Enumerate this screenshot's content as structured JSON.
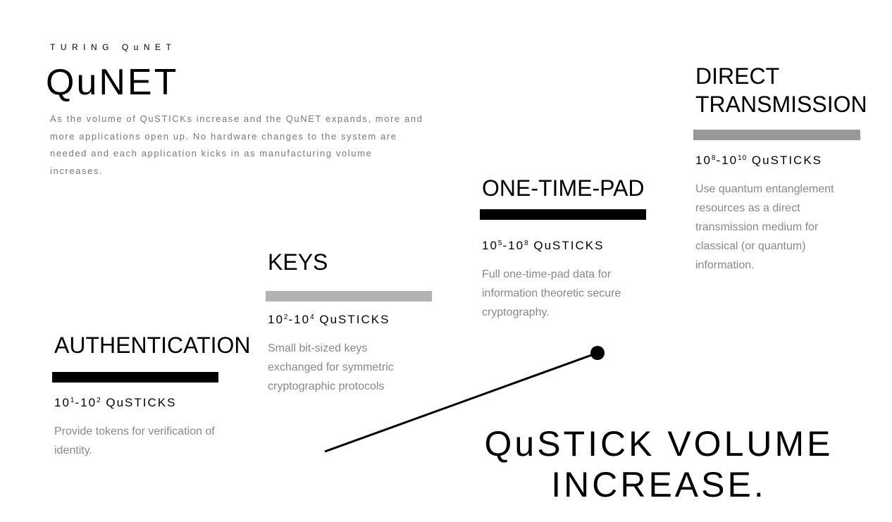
{
  "header": {
    "eyebrow": "TURING QuNET",
    "title": "QuNET",
    "intro": "As the volume of QuSTICKs increase and the QuNET expands, more and more applications open up.  No hardware changes to the system are needed and each application kicks in as manufacturing volume increases."
  },
  "colors": {
    "bar_black": "#000000",
    "bar_light_gray": "#b3b3b3",
    "bar_mid_gray": "#999999",
    "desc_text": "#888888"
  },
  "stages": [
    {
      "title": "AUTHENTICATION",
      "volume_base1": "10",
      "volume_exp1": "1",
      "volume_sep": "-",
      "volume_base2": "10",
      "volume_exp2": "2",
      "volume_unit": " QuSTICKS",
      "description": "Provide tokens for verification of identity.",
      "bar_color": "#000000"
    },
    {
      "title": "KEYS",
      "volume_base1": "10",
      "volume_exp1": "2",
      "volume_sep": "-",
      "volume_base2": "10",
      "volume_exp2": "4",
      "volume_unit": " QuSTICKS",
      "description": "Small bit-sized keys exchanged for symmetric cryptographic protocols",
      "bar_color": "#b3b3b3"
    },
    {
      "title": "ONE-TIME-PAD",
      "volume_base1": "10",
      "volume_exp1": "5",
      "volume_sep": "-",
      "volume_base2": "10",
      "volume_exp2": "8",
      "volume_unit": " QuSTICKS",
      "description": "Full one-time-pad data for information theoretic secure cryptography.",
      "bar_color": "#000000"
    },
    {
      "title": "DIRECT TRANSMISSION",
      "volume_base1": "10",
      "volume_exp1": "8",
      "volume_sep": "-",
      "volume_base2": "10",
      "volume_exp2": "10",
      "volume_unit": " QuSTICKS",
      "description": "Use quantum entanglement resources as a direct transmission medium for classical (or quantum) information.",
      "bar_color": "#999999"
    }
  ],
  "caption": {
    "line1": "QuSTICK VOLUME",
    "line2": "INCREASE."
  }
}
